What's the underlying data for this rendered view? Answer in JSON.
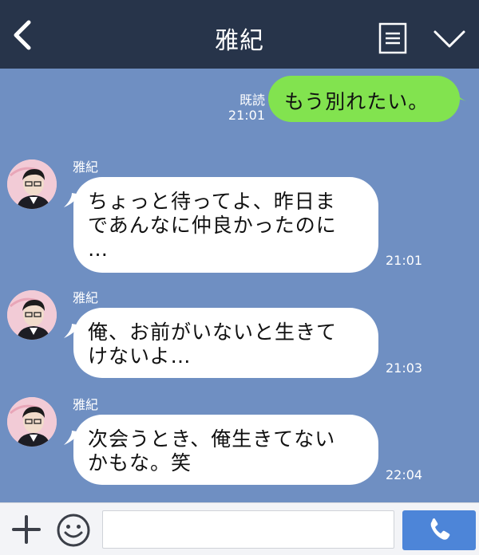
{
  "header": {
    "title": "雅紀",
    "back_icon": "chevron-left-icon",
    "menu_icon": "menu-icon",
    "collapse_icon": "chevron-down-icon"
  },
  "messages": {
    "outgoing": {
      "read_label": "既読",
      "time": "21:01",
      "text": "もう別れたい。"
    },
    "incoming": [
      {
        "sender": "雅紀",
        "lines": [
          "ちょっと待ってよ、昨日ま",
          "であんなに仲良かったのに",
          "…"
        ],
        "time": "21:01"
      },
      {
        "sender": "雅紀",
        "lines": [
          "俺、お前がいないと生きて",
          "けないよ…"
        ],
        "time": "21:03"
      },
      {
        "sender": "雅紀",
        "lines": [
          "次会うとき、俺生きてない",
          "かもな。笑"
        ],
        "time": "22:04"
      }
    ]
  },
  "footer": {
    "plus_icon": "plus-icon",
    "emoji_icon": "smiley-icon",
    "input_placeholder": "",
    "call_icon": "phone-icon"
  },
  "colors": {
    "header_bg": "#27344a",
    "chat_bg": "#6f8fc2",
    "outgoing_bubble": "#82e34f",
    "incoming_bubble": "#ffffff",
    "call_button": "#4d85d8"
  }
}
